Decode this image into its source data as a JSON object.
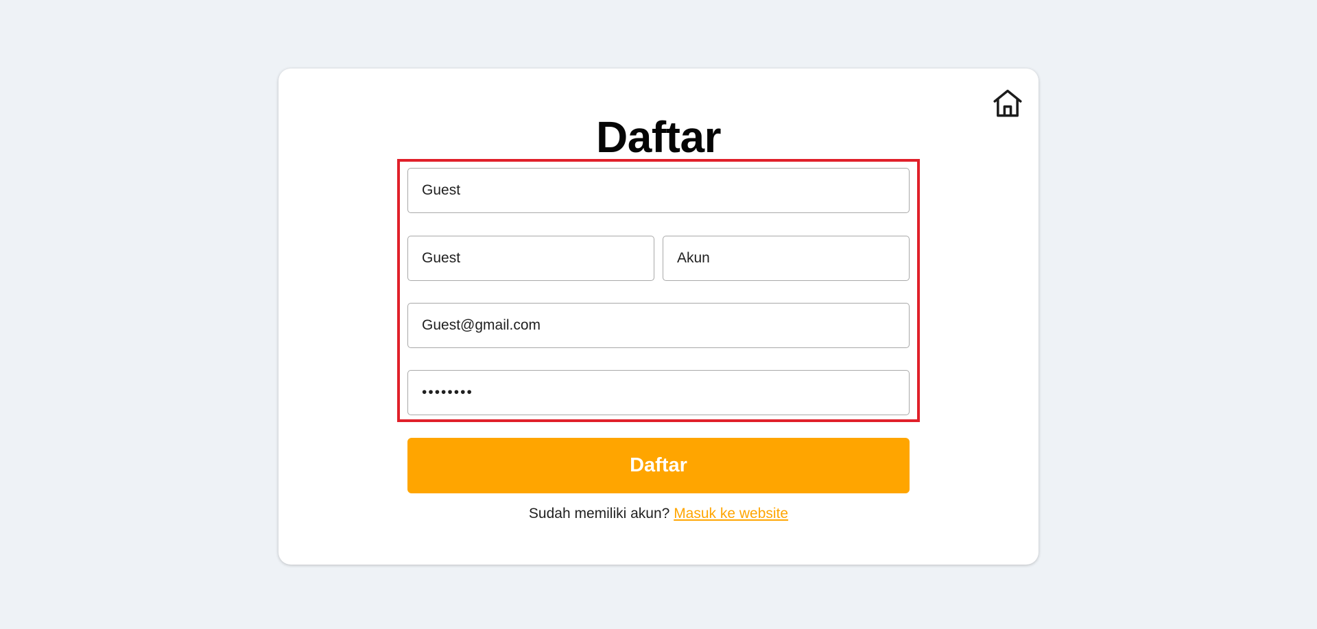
{
  "form": {
    "title": "Daftar",
    "username_value": "Guest",
    "first_name_value": "Guest",
    "last_name_value": "Akun",
    "email_value": "Guest@gmail.com",
    "password_value": "12345678",
    "submit_label": "Daftar"
  },
  "footer": {
    "prompt_text": "Sudah memiliki akun?",
    "login_link_text": "Masuk ke website"
  },
  "icons": {
    "home": "home-icon"
  },
  "colors": {
    "page_background": "#eef2f6",
    "accent": "#ffa500",
    "highlight_border": "#e0202a"
  }
}
